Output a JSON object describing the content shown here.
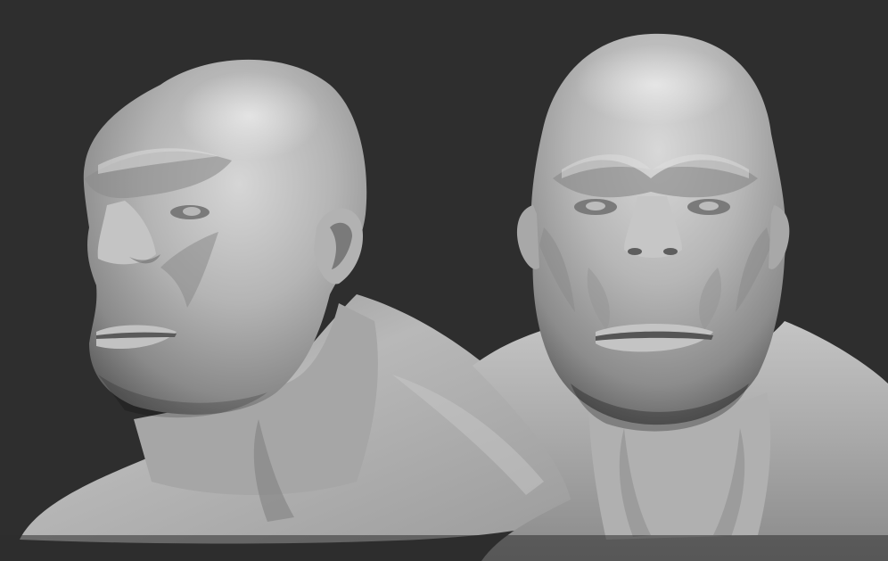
{
  "scene": {
    "background_color": "#2e2e2e",
    "clay_material_color": "#a8a8a8",
    "models": [
      {
        "name": "bust-three-quarter-view"
      },
      {
        "name": "bust-front-view"
      }
    ]
  }
}
